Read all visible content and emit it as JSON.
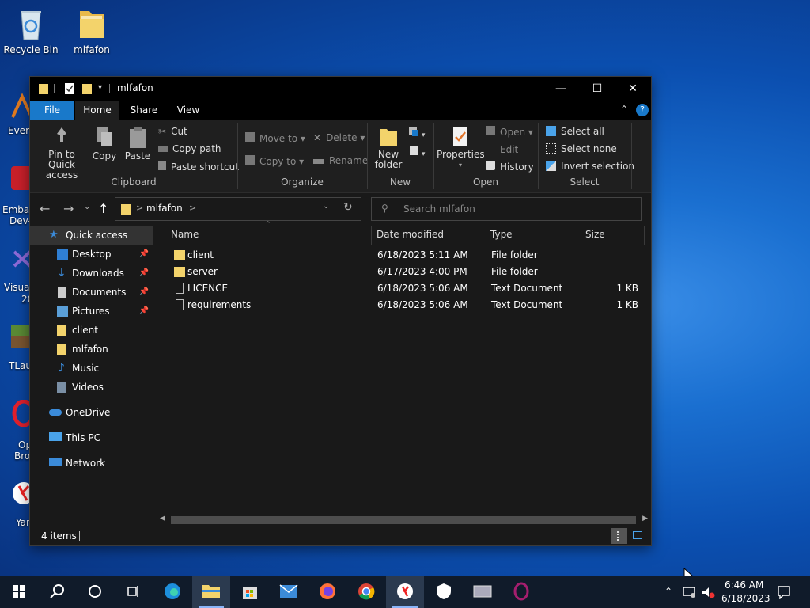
{
  "desktop": {
    "icons": [
      {
        "label": "Recycle Bin",
        "icon": "recycle-bin-icon"
      },
      {
        "label": "mlfafon",
        "icon": "folder-icon"
      }
    ],
    "partial_labels": [
      "Every",
      "Embar",
      "Dev-",
      "Visual",
      "20",
      "TLaun",
      "Op",
      "Brow",
      "Yan"
    ]
  },
  "window": {
    "title": "mlfafon",
    "controls": {
      "minimize": "—",
      "maximize": "☐",
      "close": "✕"
    },
    "tabs": [
      {
        "label": "File"
      },
      {
        "label": "Home"
      },
      {
        "label": "Share"
      },
      {
        "label": "View"
      }
    ],
    "ribbon": {
      "clipboard": {
        "pin": "Pin to Quick access",
        "copy": "Copy",
        "paste": "Paste",
        "cut": "Cut",
        "copy_path": "Copy path",
        "paste_shortcut": "Paste shortcut",
        "group": "Clipboard"
      },
      "organize": {
        "move_to": "Move to",
        "copy_to": "Copy to",
        "delete": "Delete",
        "rename": "Rename",
        "group": "Organize"
      },
      "new": {
        "new_folder": "New folder",
        "group": "New"
      },
      "open": {
        "properties": "Properties",
        "open": "Open",
        "edit": "Edit",
        "history": "History",
        "group": "Open"
      },
      "select": {
        "select_all": "Select all",
        "select_none": "Select none",
        "invert": "Invert selection",
        "group": "Select"
      }
    },
    "address": {
      "path": "mlfafon",
      "chevron": ">"
    },
    "search": {
      "placeholder": "Search mlfafon"
    },
    "nav": {
      "quick_access": "Quick access",
      "items": [
        {
          "label": "Desktop",
          "pinned": true,
          "icon": "desktop-icon"
        },
        {
          "label": "Downloads",
          "pinned": true,
          "icon": "downloads-icon"
        },
        {
          "label": "Documents",
          "pinned": true,
          "icon": "documents-icon"
        },
        {
          "label": "Pictures",
          "pinned": true,
          "icon": "pictures-icon"
        },
        {
          "label": "client",
          "pinned": false,
          "icon": "folder-icon"
        },
        {
          "label": "mlfafon",
          "pinned": false,
          "icon": "folder-icon"
        },
        {
          "label": "Music",
          "pinned": false,
          "icon": "music-icon"
        },
        {
          "label": "Videos",
          "pinned": false,
          "icon": "videos-icon"
        }
      ],
      "onedrive": "OneDrive",
      "this_pc": "This PC",
      "network": "Network"
    },
    "columns": {
      "name": "Name",
      "date": "Date modified",
      "type": "Type",
      "size": "Size"
    },
    "files": [
      {
        "name": "client",
        "date": "6/18/2023 5:11 AM",
        "type": "File folder",
        "size": "",
        "icon": "folder-icon"
      },
      {
        "name": "server",
        "date": "6/17/2023 4:00 PM",
        "type": "File folder",
        "size": "",
        "icon": "folder-icon"
      },
      {
        "name": "LICENCE",
        "date": "6/18/2023 5:06 AM",
        "type": "Text Document",
        "size": "1 KB",
        "icon": "text-document-icon"
      },
      {
        "name": "requirements",
        "date": "6/18/2023 5:06 AM",
        "type": "Text Document",
        "size": "1 KB",
        "icon": "text-document-icon"
      }
    ],
    "status": {
      "items": "4 items"
    }
  },
  "taskbar": {
    "clock_time": "6:46 AM",
    "clock_date": "6/18/2023",
    "apps": [
      "start-icon",
      "search-icon",
      "cortana-icon",
      "task-view-icon",
      "edge-icon",
      "file-explorer-icon",
      "store-icon",
      "mail-icon",
      "firefox-icon",
      "chrome-icon",
      "yandex-icon",
      "security-icon",
      "network-app-icon",
      "opera-icon"
    ]
  },
  "colors": {
    "accent": "#1979ca",
    "window_bg": "#191919",
    "ribbon_bg": "#1f1f1f",
    "folder": "#f3d36b"
  }
}
